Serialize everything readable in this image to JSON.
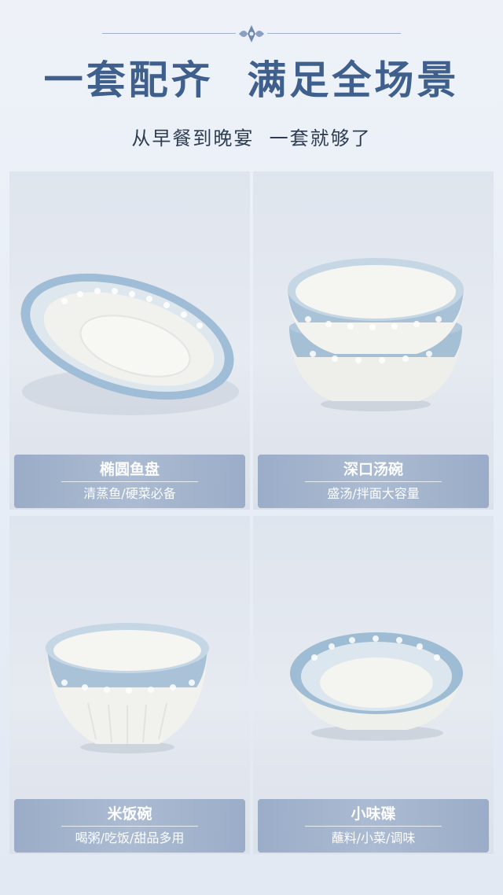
{
  "header": {
    "title": "一套配齐  满足全场景",
    "subtitle": "从早餐到晚宴  一套就够了"
  },
  "products": [
    {
      "name": "椭圆鱼盘",
      "desc": "清蒸鱼/硬菜必备",
      "image_icon": "oval-fish-plate"
    },
    {
      "name": "深口汤碗",
      "desc": "盛汤/拌面大容量",
      "image_icon": "deep-soup-bowl"
    },
    {
      "name": "米饭碗",
      "desc": "喝粥/吃饭/甜品多用",
      "image_icon": "rice-bowl"
    },
    {
      "name": "小味碟",
      "desc": "蘸料/小菜/调味",
      "image_icon": "small-sauce-dish"
    }
  ],
  "colors": {
    "title": "#3f5f8c",
    "label_bg": "#a3b4cd",
    "glaze_blue": "#8fb0cc",
    "porcelain": "#f4f4ef"
  }
}
